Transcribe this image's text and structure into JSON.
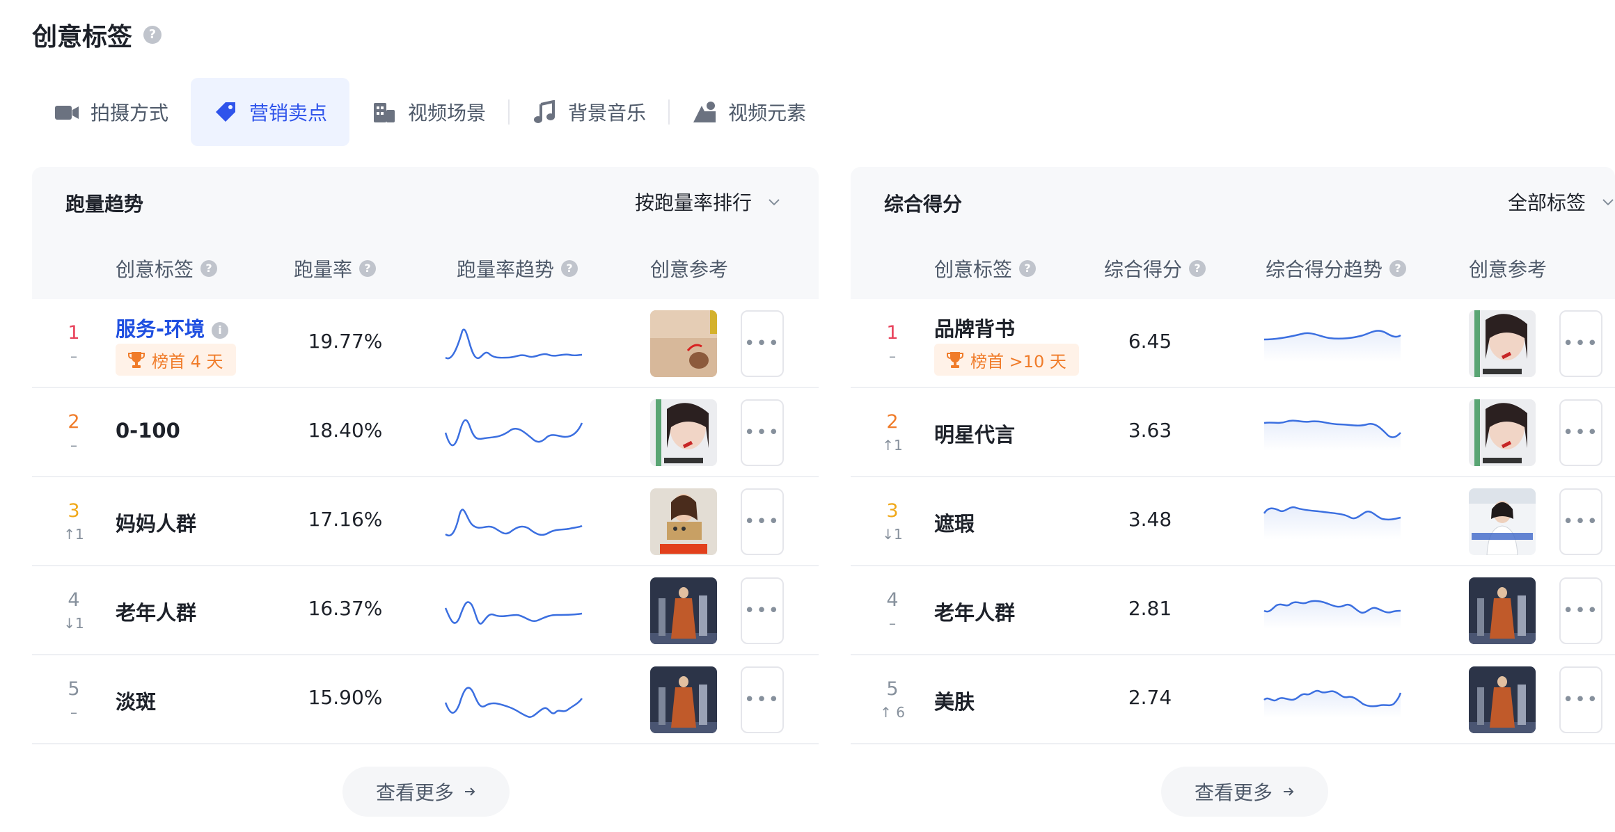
{
  "page": {
    "title": "创意标签"
  },
  "tabs": [
    {
      "label": "拍摄方式",
      "icon": "camera-icon",
      "active": false
    },
    {
      "label": "营销卖点",
      "icon": "tag-icon",
      "active": true
    },
    {
      "label": "视频场景",
      "icon": "building-icon",
      "active": false
    },
    {
      "label": "背景音乐",
      "icon": "music-note-icon",
      "active": false
    },
    {
      "label": "视频元素",
      "icon": "shapes-icon",
      "active": false
    }
  ],
  "left_panel": {
    "title": "跑量趋势",
    "sort_label": "按跑量率排行",
    "columns": {
      "tag": "创意标签",
      "value": "跑量率",
      "trend": "跑量率趋势",
      "ref": "创意参考"
    },
    "rows": [
      {
        "rank": "1",
        "change": "–",
        "name": "服务-环境",
        "badge": "榜首 4 天",
        "value": "19.77%",
        "thumb": "skin-closeup"
      },
      {
        "rank": "2",
        "change": "–",
        "name": "0-100",
        "badge": "",
        "value": "18.40%",
        "thumb": "woman-face"
      },
      {
        "rank": "3",
        "change": "↑1",
        "name": "妈妈人群",
        "badge": "",
        "value": "17.16%",
        "thumb": "woman-studio"
      },
      {
        "rank": "4",
        "change": "↓1",
        "name": "老年人群",
        "badge": "",
        "value": "16.37%",
        "thumb": "runway"
      },
      {
        "rank": "5",
        "change": "–",
        "name": "淡斑",
        "badge": "",
        "value": "15.90%",
        "thumb": "runway"
      }
    ],
    "see_more": "查看更多"
  },
  "right_panel": {
    "title": "综合得分",
    "sort_label": "全部标签",
    "columns": {
      "tag": "创意标签",
      "value": "综合得分",
      "trend": "综合得分趋势",
      "ref": "创意参考"
    },
    "rows": [
      {
        "rank": "1",
        "change": "–",
        "name": "品牌背书",
        "badge": "榜首 >10 天",
        "value": "6.45",
        "thumb": "woman-face"
      },
      {
        "rank": "2",
        "change": "↑1",
        "name": "明星代言",
        "badge": "",
        "value": "3.63",
        "thumb": "woman-face"
      },
      {
        "rank": "3",
        "change": "↓1",
        "name": "遮瑕",
        "badge": "",
        "value": "3.48",
        "thumb": "news-anchor"
      },
      {
        "rank": "4",
        "change": "–",
        "name": "老年人群",
        "badge": "",
        "value": "2.81",
        "thumb": "runway"
      },
      {
        "rank": "5",
        "change": "↑ 6",
        "name": "美肤",
        "badge": "",
        "value": "2.74",
        "thumb": "runway"
      }
    ],
    "see_more": "查看更多"
  },
  "colors": {
    "accent": "#2f54eb",
    "rank1": "#e8425b",
    "rank2": "#f07c2a",
    "rank3": "#f0a818",
    "badge_bg": "#fff2e8",
    "badge_text": "#f07c2a",
    "sparkline": "#3b6fe0"
  }
}
